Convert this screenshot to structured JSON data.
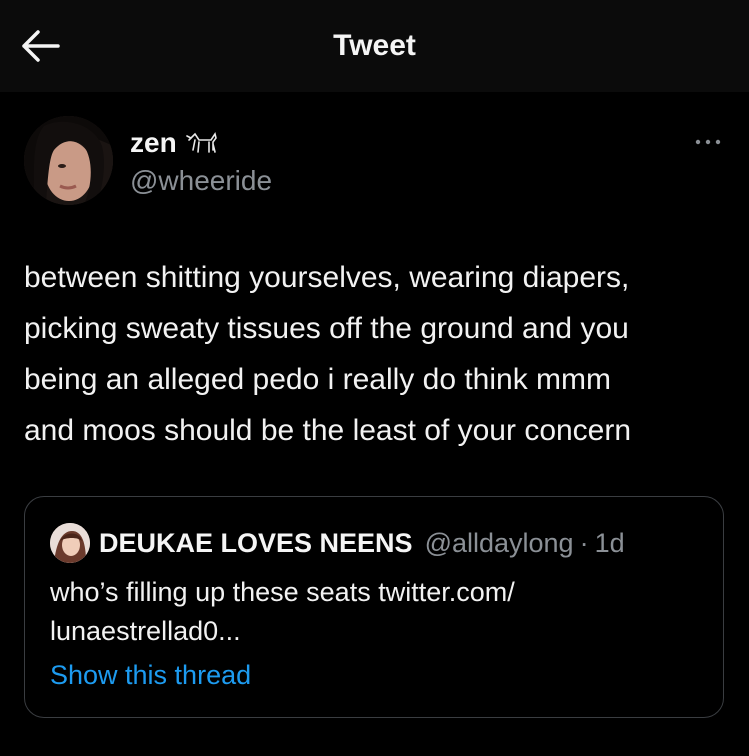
{
  "header": {
    "title": "Tweet",
    "back_icon": "arrow-left-icon"
  },
  "author": {
    "display_name": "zen",
    "name_emoji": "🐕",
    "handle": "@wheeride",
    "more_icon": "more-horizontal-icon"
  },
  "tweet": {
    "lines": [
      "between shitting yourselves, wearing diapers,",
      "picking sweaty tissues off the ground and you",
      "being an alleged pedo i really do think mmm",
      "and moos should be the least of your concern"
    ]
  },
  "quote": {
    "name": "DEUKAE LOVES NEENS",
    "handle": "@alldaylong",
    "separator": "·",
    "time": "1d",
    "lines": [
      "who’s filling up these seats twitter.com/",
      "lunaestrellad0..."
    ],
    "show_thread": "Show this thread"
  },
  "colors": {
    "background": "#000000",
    "header_bg": "#0b0b0b",
    "text": "#f2f2f2",
    "muted": "#8b9096",
    "link": "#1d9bf0",
    "border": "#3a3d41"
  }
}
